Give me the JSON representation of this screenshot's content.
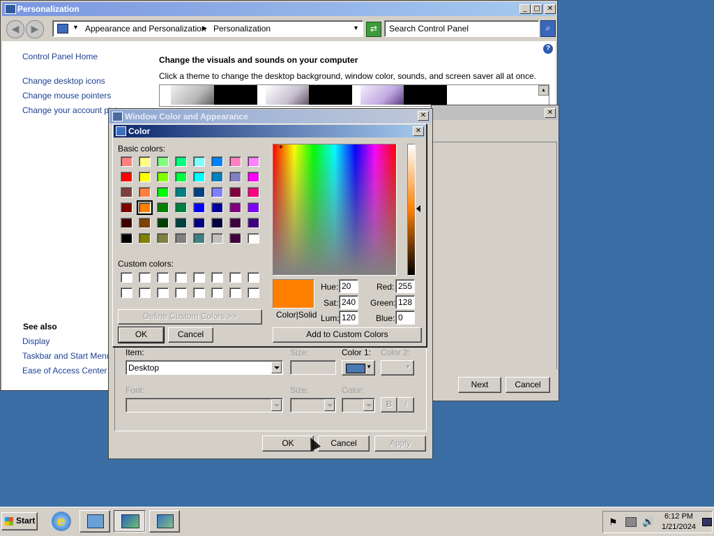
{
  "personalization": {
    "title": "Personalization",
    "breadcrumb": [
      "Appearance and Personalization",
      "Personalization"
    ],
    "search_placeholder": "Search Control Panel",
    "sidebar": {
      "home": "Control Panel Home",
      "links": [
        "Change desktop icons",
        "Change mouse pointers",
        "Change your account picture"
      ],
      "see_also_heading": "See also",
      "see_also": [
        "Display",
        "Taskbar and Start Menu",
        "Ease of Access Center"
      ]
    },
    "heading": "Change the visuals and sounds on your computer",
    "subheading": "Click a theme to change the desktop background, window color, sounds, and screen saver all at once.",
    "wizard_buttons": {
      "next": "Next",
      "cancel": "Cancel"
    }
  },
  "wca": {
    "title": "Window Color and Appearance",
    "item_label": "Item:",
    "item_value": "Desktop",
    "size_label": "Size:",
    "color1_label": "Color 1:",
    "color2_label": "Color 2:",
    "font_label": "Font:",
    "font_size_label": "Size:",
    "font_color_label": "Color:",
    "bold": "B",
    "italic": "I",
    "ok": "OK",
    "cancel": "Cancel",
    "apply": "Apply",
    "color1_swatch": "#4a78b0"
  },
  "color": {
    "title": "Color",
    "basic_label": "Basic colors:",
    "custom_label": "Custom colors:",
    "define_button": "Define Custom Colors >>",
    "ok": "OK",
    "cancel": "Cancel",
    "add_button": "Add to Custom Colors",
    "colorsolid_label": "Color|Solid",
    "preview_color": "#ff8000",
    "selected_index": 25,
    "fields": {
      "hue_label": "Hue:",
      "hue": "20",
      "sat_label": "Sat:",
      "sat": "240",
      "lum_label": "Lum:",
      "lum": "120",
      "red_label": "Red:",
      "red": "255",
      "green_label": "Green:",
      "green": "128",
      "blue_label": "Blue:",
      "blue": "0"
    },
    "basic_colors": [
      "#ff8080",
      "#ffff80",
      "#80ff80",
      "#00ff80",
      "#80ffff",
      "#0080ff",
      "#ff80c0",
      "#ff80ff",
      "#ff0000",
      "#ffff00",
      "#80ff00",
      "#00ff40",
      "#00ffff",
      "#0080c0",
      "#8080c0",
      "#ff00ff",
      "#804040",
      "#ff8040",
      "#00ff00",
      "#008080",
      "#004080",
      "#8080ff",
      "#800040",
      "#ff0080",
      "#800000",
      "#ff8000",
      "#008000",
      "#008040",
      "#0000ff",
      "#0000a0",
      "#800080",
      "#8000ff",
      "#400000",
      "#804000",
      "#004000",
      "#004040",
      "#000080",
      "#000040",
      "#400040",
      "#400080",
      "#000000",
      "#808000",
      "#808040",
      "#808080",
      "#408080",
      "#c0c0c0",
      "#400040",
      "#ffffff"
    ]
  },
  "taskbar": {
    "start": "Start",
    "time": "6:12 PM",
    "date": "1/21/2024"
  }
}
